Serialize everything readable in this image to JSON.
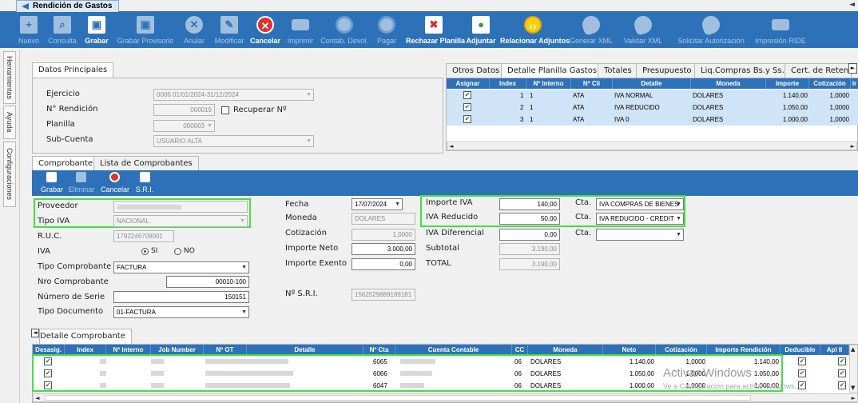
{
  "window": {
    "tab_title": "Rendición de Gastos"
  },
  "toolbar": [
    {
      "id": "nuevo",
      "label": "Nuevo",
      "icon": "new-doc-icon",
      "enabled": false
    },
    {
      "id": "consulta",
      "label": "Consulta",
      "icon": "search-doc-icon",
      "enabled": false
    },
    {
      "id": "grabar",
      "label": "Grabar",
      "icon": "save-icon",
      "enabled": true
    },
    {
      "id": "grabar-provisorio",
      "label": "Grabar Provisorio",
      "icon": "save-icon",
      "enabled": false
    },
    {
      "id": "anular",
      "label": "Anular",
      "icon": "cancel-icon",
      "enabled": false
    },
    {
      "id": "modificar",
      "label": "Modificar",
      "icon": "edit-icon",
      "enabled": false
    },
    {
      "id": "cancelar",
      "label": "Cancelar",
      "icon": "cancel-icon",
      "enabled": true
    },
    {
      "id": "imprimir",
      "label": "Imprimir",
      "icon": "printer-icon",
      "enabled": false
    },
    {
      "id": "contab-devol",
      "label": "Contab. Devol.",
      "icon": "globe-icon",
      "enabled": false
    },
    {
      "id": "pagar",
      "label": "Pagar",
      "icon": "globe-icon",
      "enabled": false
    },
    {
      "id": "rechazar-planilla",
      "label": "Rechazar Planilla",
      "icon": "reject-doc-icon",
      "enabled": true
    },
    {
      "id": "adjuntar",
      "label": "Adjuntar",
      "icon": "attach-doc-icon",
      "enabled": true
    },
    {
      "id": "relacionar-adjuntos",
      "label": "Relacionar Adjuntos",
      "icon": "code-icon",
      "enabled": true
    },
    {
      "id": "generar-xml",
      "label": "Generar XML",
      "icon": "drop-icon",
      "enabled": false
    },
    {
      "id": "validar-xml",
      "label": "Validar XML",
      "icon": "drop-icon",
      "enabled": false
    },
    {
      "id": "solicitar-autorizacion",
      "label": "Solicitar Autorización",
      "icon": "drop-icon",
      "enabled": false
    },
    {
      "id": "impresion-ride",
      "label": "Impresión RIDE",
      "icon": "printer-icon",
      "enabled": false
    }
  ],
  "side_tabs": [
    "Herramientas",
    "Ayuda",
    "Configuraciones"
  ],
  "datos": {
    "tab": "Datos Principales",
    "ejercicio_label": "Ejercicio",
    "ejercicio": "0006 01/01/2024-31/12/2024",
    "rendicion_label": "N° Rendición",
    "rendicion": "000019",
    "recuperar_label": "Recuperar Nº",
    "planilla_label": "Planilla",
    "planilla": "000003",
    "subcuenta_label": "Sub-Cuenta",
    "subcuenta": "USUARIO ALTA"
  },
  "planilla": {
    "tabs": [
      "Otros Datos",
      "Detalle Planilla Gastos",
      "Totales",
      "Presupuesto",
      "Liq.Compras Bs.y Ss.",
      "Cert. de Reten"
    ],
    "headers": [
      "Asignar",
      "Index",
      "Nº Interno",
      "Nº Cli",
      "Detalle",
      "Moneda",
      "Importe",
      "Cotización",
      "Ir"
    ],
    "rows": [
      {
        "index": "1",
        "interno": "1",
        "cli": "ATA",
        "detalle": "IVA NORMAL",
        "moneda": "DOLARES",
        "importe": "1.140,00",
        "cot": "1,0000"
      },
      {
        "index": "2",
        "interno": "1",
        "cli": "ATA",
        "detalle": "IVA REDUCIDO",
        "moneda": "DOLARES",
        "importe": "1.050,00",
        "cot": "1,0000"
      },
      {
        "index": "3",
        "interno": "1",
        "cli": "ATA",
        "detalle": "IVA 0",
        "moneda": "DOLARES",
        "importe": "1.000,00",
        "cot": "1,0000"
      }
    ]
  },
  "comp": {
    "tabs": [
      "Comprobante",
      "Lista de Comprobantes"
    ],
    "tools": [
      "Grabar",
      "Eliminar",
      "Cancelar",
      "S.R.I."
    ],
    "proveedor_label": "Proveedor",
    "tipoiva_label": "Tipo IVA",
    "tipoiva": "NACIONAL",
    "ruc_label": "R.U.C.",
    "ruc": "1792246709001",
    "iva_label": "IVA",
    "si": "SI",
    "no": "NO",
    "tipocomp_label": "Tipo Comprobante",
    "tipocomp": "FACTURA",
    "nrocomp_label": "Nro Comprobante",
    "nrocomp": "00010-100",
    "serie_label": "Número de Serie",
    "serie": "150151",
    "tipodoc_label": "Tipo Documento",
    "tipodoc": "01-FACTURA",
    "fecha_label": "Fecha",
    "fecha": "17/07/2024",
    "moneda_label": "Moneda",
    "moneda": "DOLARES",
    "cotizacion_label": "Cotización",
    "cotizacion": "1,0000",
    "neto_label": "Importe Neto",
    "neto": "3.000,00",
    "exento_label": "Importe Exento",
    "exento": "0,00",
    "sri_label": "Nº S.R.I.",
    "sri": "1562529889189181",
    "imp_iva_label": "Importe IVA",
    "imp_iva": "140,00",
    "iva_red_label": "IVA Reducido",
    "iva_red": "50,00",
    "iva_dif_label": "IVA Diferencial",
    "iva_dif": "0,00",
    "subtotal_label": "Subtotal",
    "subtotal": "3.190,00",
    "total_label": "TOTAL",
    "total": "3.190,00",
    "cta_label": "Cta.",
    "cta1": "IVA COMPRAS DE BIENES",
    "cta2": "IVA REDUCIDO - CREDIT"
  },
  "detalle": {
    "tab": "Detalle Comprobante",
    "headers": [
      "Desasig.",
      "Index",
      "Nº Interno",
      "Job Number",
      "Nº OT",
      "Detalle",
      "Nº Cta",
      "Cuenta Contable",
      "CC",
      "Moneda",
      "Neto",
      "Cotización",
      "Importe Rendición",
      "Deducible",
      "Apl II"
    ],
    "rows": [
      {
        "cta": "6065",
        "cc": "06",
        "moneda": "DOLARES",
        "neto": "1.140,00",
        "cot": "1,0000",
        "importe": "1.140,00"
      },
      {
        "cta": "6066",
        "cc": "06",
        "moneda": "DOLARES",
        "neto": "1.050,00",
        "cot": "1,0000",
        "importe": "1.050,00"
      },
      {
        "cta": "6047",
        "cc": "06",
        "moneda": "DOLARES",
        "neto": "1.000,00",
        "cot": "1,0000",
        "importe": "1.000,00"
      }
    ]
  },
  "watermark": {
    "title": "Activar Windows",
    "sub": "Ve a Configuración para activar Windows."
  },
  "colors": {
    "toolbar": "#2d72b8",
    "highlight": "#3ee23e",
    "grid_row": "#cfe4f7"
  }
}
